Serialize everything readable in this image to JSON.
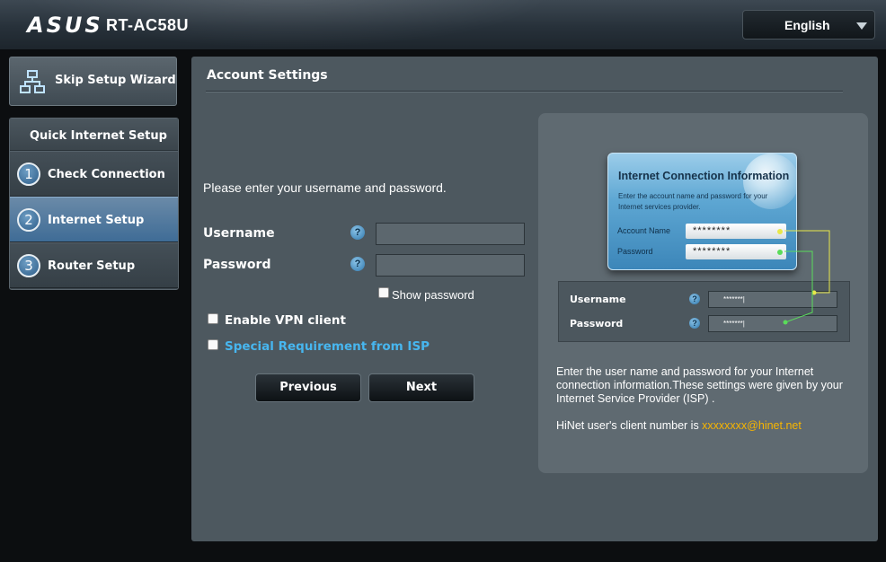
{
  "header": {
    "logo": "ASUS",
    "model": "RT-AC58U",
    "language": "English"
  },
  "sidebar": {
    "skip_wizard": "Skip Setup Wizard",
    "qis_title": "Quick Internet Setup",
    "steps": [
      {
        "num": "1",
        "label": "Check Connection"
      },
      {
        "num": "2",
        "label": "Internet Setup"
      },
      {
        "num": "3",
        "label": "Router Setup"
      }
    ]
  },
  "main": {
    "title": "Account Settings",
    "intro": "Please enter your username and password.",
    "username_label": "Username",
    "password_label": "Password",
    "help_glyph": "?",
    "username_value": "",
    "password_value": "",
    "show_password": "Show password",
    "enable_vpn": "Enable VPN client",
    "special_isp": "Special Requirement from ISP",
    "previous": "Previous",
    "next": "Next"
  },
  "info": {
    "card_title": "Internet Connection Information",
    "card_desc": "Enter the account name and password for your Internet services provider.",
    "card_account_label": "Account Name",
    "card_password_label": "Password",
    "card_account_value": "********",
    "card_password_value": "********",
    "mini_username": "Username",
    "mini_password": "Password",
    "mini_value": "*******|",
    "text": "Enter the user name and password for your Internet connection information.These settings were given by your Internet Service Provider (ISP) .",
    "hinet_prefix": "HiNet user's client number is ",
    "hinet_email": "xxxxxxxx@hinet.net",
    "colors": {
      "highlight": "#f7b500",
      "link": "#47b6ef",
      "connector_yellow": "#e8e84a",
      "connector_green": "#5adc5a"
    }
  }
}
